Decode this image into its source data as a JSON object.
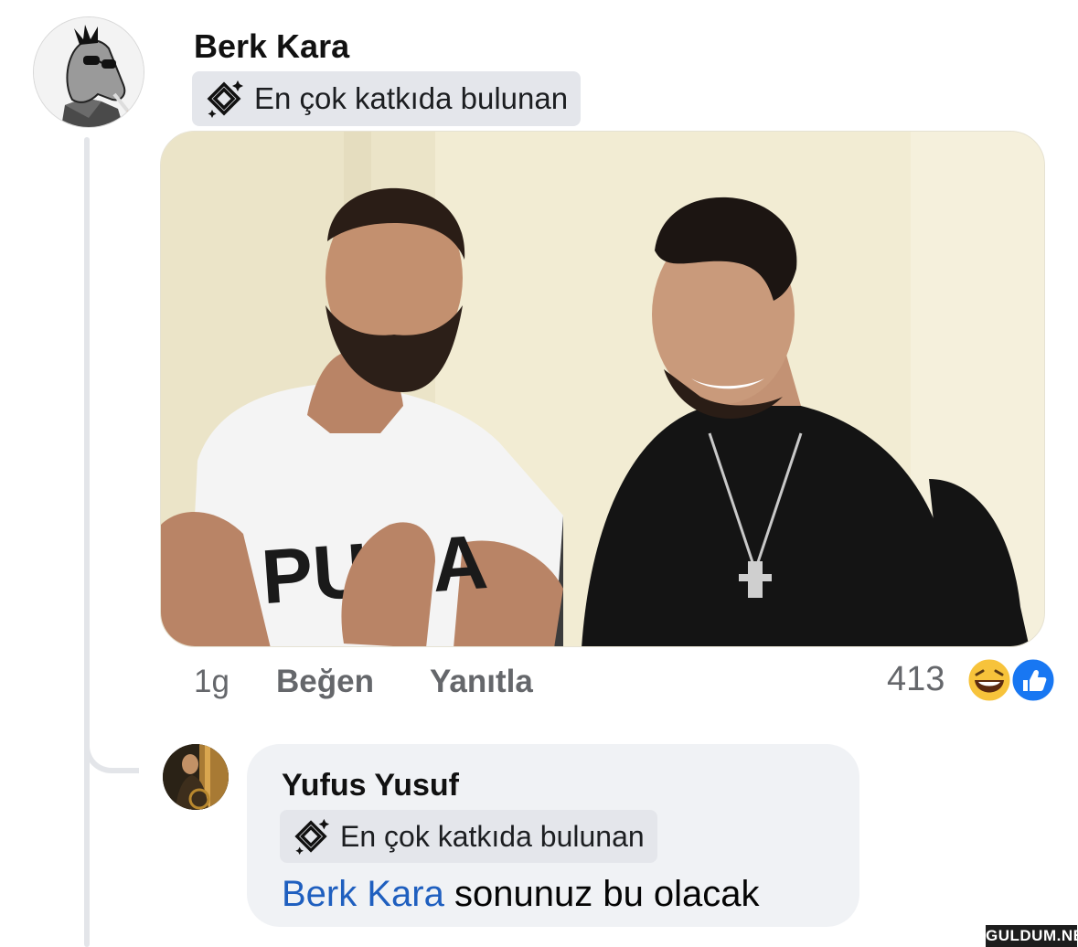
{
  "comment": {
    "author": "Berk Kara",
    "badge": "En çok katkıda bulunan",
    "avatar_icon": "horse-cartoon-avatar",
    "media_description_icon": "photo-attachment",
    "actions": {
      "time": "1g",
      "like": "Beğen",
      "reply": "Yanıtla"
    },
    "reactions": {
      "count": "413",
      "icons": [
        "laughing-emoji-icon",
        "thumbs-up-icon"
      ]
    }
  },
  "reply": {
    "author": "Yufus Yusuf",
    "badge": "En çok katkıda bulunan",
    "mention": "Berk Kara",
    "text": " sonunuz bu olacak"
  },
  "watermark": "GULDUM.NET",
  "colors": {
    "badge_bg": "#e4e6eb",
    "bubble_bg": "#f0f2f5",
    "mention": "#1f5fbf",
    "muted_text": "#65676b",
    "like_blue": "#1877f2",
    "emoji_yellow": "#f7c33b"
  }
}
